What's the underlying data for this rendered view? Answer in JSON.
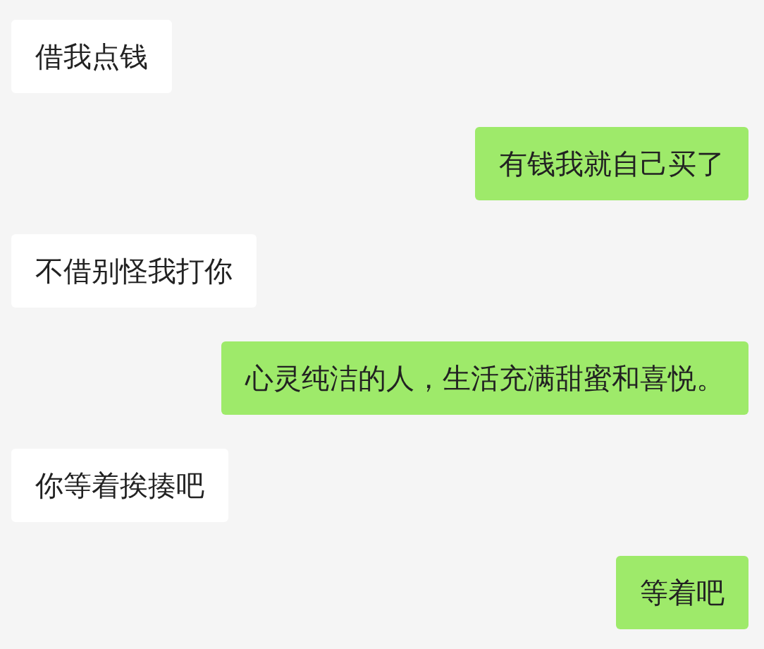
{
  "messages": [
    {
      "kind": "received",
      "text": "借我点钱"
    },
    {
      "kind": "sent",
      "text": "有钱我就自己买了"
    },
    {
      "kind": "received",
      "text": "不借别怪我打你"
    },
    {
      "kind": "sent",
      "text": "心灵纯洁的人，生活充满甜蜜和喜悦。"
    },
    {
      "kind": "received",
      "text": "你等着挨揍吧"
    },
    {
      "kind": "sent",
      "text": "等着吧"
    }
  ]
}
